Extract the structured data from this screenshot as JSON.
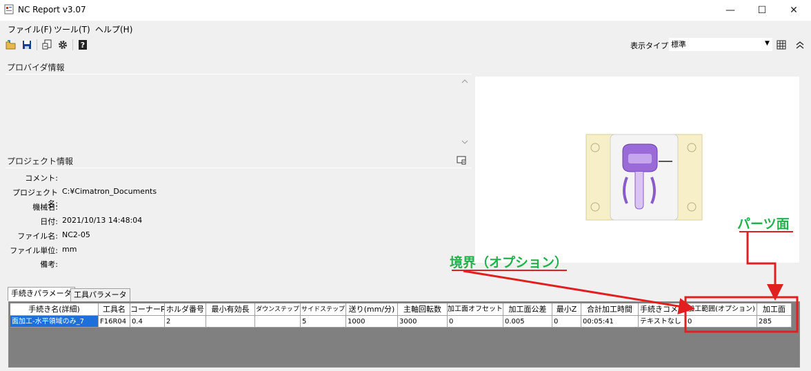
{
  "window": {
    "title": "NC Report v3.07",
    "minimize": "—",
    "maximize": "☐",
    "close": "✕"
  },
  "menu": [
    "ファイル(F)",
    "ツール(T)",
    "ヘルプ(H)"
  ],
  "toolbar": {
    "icons": [
      "open-folder-icon",
      "save-icon",
      "export-icon",
      "settings-gear-icon",
      "help-icon"
    ],
    "display_type_label": "表示タイプ",
    "display_type_value": "標準"
  },
  "provider": {
    "header": "プロバイダ情報"
  },
  "project": {
    "header": "プロジェクト情報",
    "rows": [
      {
        "label": "コメント:",
        "value": ""
      },
      {
        "label": "プロジェクト名:",
        "value": "C:¥Cimatron_Documents"
      },
      {
        "label": "機械名:",
        "value": ""
      },
      {
        "label": "日付:",
        "value": "2021/10/13 14:48:04"
      },
      {
        "label": "ファイル名:",
        "value": "NC2-05"
      },
      {
        "label": "ファイル単位:",
        "value": "mm"
      },
      {
        "label": "備考:",
        "value": ""
      }
    ]
  },
  "tabs": [
    "手続きパラメータ",
    "工具パラメータ"
  ],
  "grid": {
    "headers": [
      "手続き名(詳細)",
      "工具名",
      "コーナーR",
      "ホルダ番号",
      "最小有効長",
      "ダウンステップ",
      "サイドステップ",
      "送り(mm/分)",
      "主軸回転数",
      "加工面オフセット",
      "加工面公差",
      "最小Z",
      "合計加工時間",
      "手続きコメント",
      "加工範囲(オプション)",
      "加工面"
    ],
    "row": [
      "面加工-水平領域のみ_7",
      "F16R04",
      "0.4",
      "2",
      "",
      "",
      "5",
      "1000",
      "3000",
      "0",
      "0.005",
      "0",
      "00:05:41",
      "テキストなし",
      "0",
      "285"
    ]
  },
  "annotations": {
    "boundary_label": "境界（オプション）",
    "part_face_label": "パーツ面",
    "color": "#e02020",
    "text_color": "#22b14c"
  }
}
